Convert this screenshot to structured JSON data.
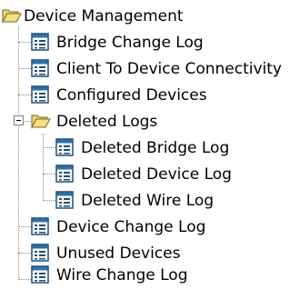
{
  "tree": {
    "root": {
      "label": "Device Management",
      "icon": "folder-open-icon"
    },
    "items": [
      {
        "label": "Bridge Change Log",
        "icon": "report-icon"
      },
      {
        "label": "Client To Device Connectivity",
        "icon": "report-icon"
      },
      {
        "label": "Configured Devices",
        "icon": "report-icon"
      },
      {
        "label": "Deleted Logs",
        "icon": "folder-open-icon",
        "expanded": true,
        "children": [
          {
            "label": "Deleted Bridge Log",
            "icon": "report-icon"
          },
          {
            "label": "Deleted Device Log",
            "icon": "report-icon"
          },
          {
            "label": "Deleted Wire Log",
            "icon": "report-icon"
          }
        ]
      },
      {
        "label": "Device Change Log",
        "icon": "report-icon"
      },
      {
        "label": "Unused Devices",
        "icon": "report-icon"
      },
      {
        "label": "Wire Change Log",
        "icon": "report-icon"
      }
    ]
  },
  "colors": {
    "folder_fill": "#f5d36b",
    "folder_stroke": "#7a6420",
    "report_frame": "#1f4f7a",
    "report_header": "#2f6fa7",
    "guide_line": "#8a8a8a"
  }
}
